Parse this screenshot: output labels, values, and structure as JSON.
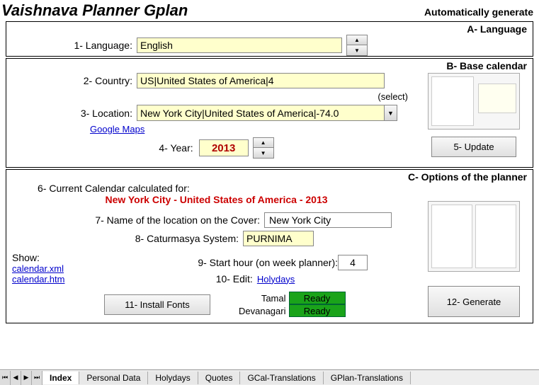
{
  "header": {
    "title": "Vaishnava Planner Gplan",
    "subtitle": "Automatically generate"
  },
  "sectionA": {
    "label": "A- Language",
    "row1_label": "1- Language:",
    "language": "English"
  },
  "sectionB": {
    "label": "B- Base calendar",
    "row2_label": "2- Country:",
    "country": "US|United States of America|4",
    "select_hint": "(select)",
    "row3_label": "3- Location:",
    "location": "New York City|United States of America|-74.0",
    "maps_link": "Google Maps",
    "row4_label": "4- Year:",
    "year": "2013",
    "update_btn": "5- Update"
  },
  "sectionC": {
    "label": "C- Options of the planner",
    "calc_label": "6- Current Calendar calculated for:",
    "calc_value": "New York City - United States of America - 2013",
    "row7_label": "7- Name of the location on the Cover:",
    "cover_name": "New York City",
    "row8_label": "8- Caturmasya System:",
    "caturmasya": "PURNIMA",
    "show_label": "Show:",
    "show_xml": "calendar.xml",
    "show_htm": "calendar.htm",
    "row9_label": "9- Start hour (on week planner):",
    "start_hour": "4",
    "row10_label": "10- Edit:",
    "holydays_link": "Holydays",
    "install_btn": "11- Install Fonts",
    "font1_label": "Tamal",
    "font2_label": "Devanagari",
    "ready1": "Ready",
    "ready2": "Ready",
    "generate_btn": "12- Generate"
  },
  "tabs": {
    "items": [
      "Index",
      "Personal Data",
      "Holydays",
      "Quotes",
      "GCal-Translations",
      "GPlan-Translations"
    ]
  }
}
